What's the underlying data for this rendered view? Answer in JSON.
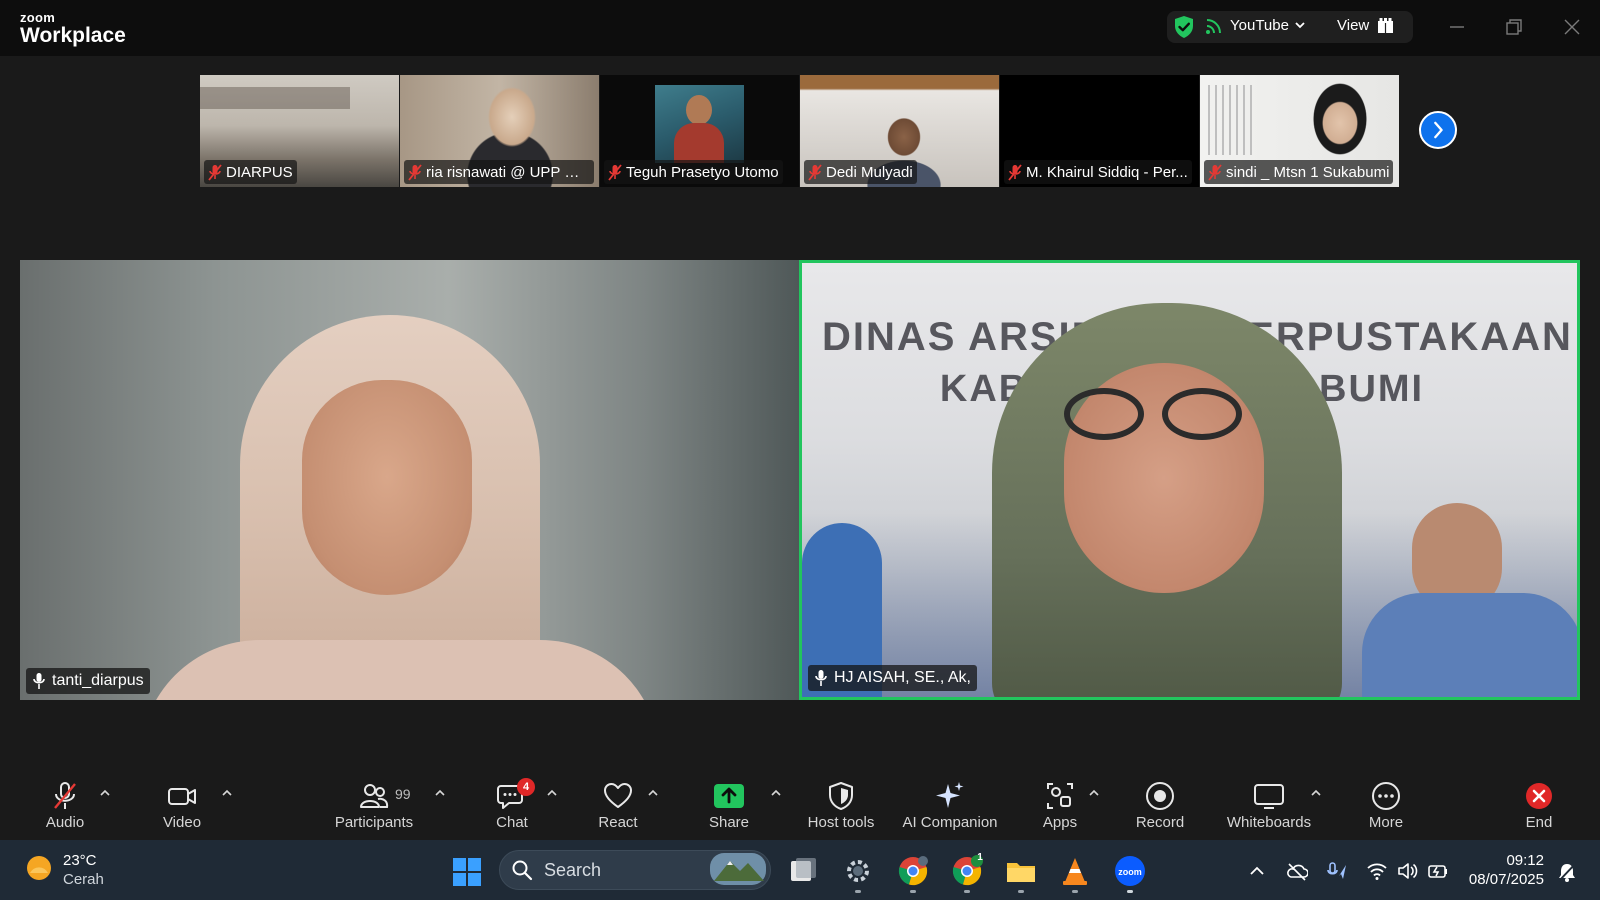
{
  "app": {
    "logo_top": "zoom",
    "logo_bottom": "Workplace"
  },
  "titlebar": {
    "stream_label": "YouTube",
    "view_label": "View"
  },
  "thumbnails": [
    {
      "name": "DIARPUS"
    },
    {
      "name": "ria risnawati @ UPP Cl..."
    },
    {
      "name": "Teguh Prasetyo Utomo"
    },
    {
      "name": "Dedi Mulyadi"
    },
    {
      "name": "M. Khairul Siddiq - Per..."
    },
    {
      "name": "sindi _ Mtsn 1 Sukabumi"
    }
  ],
  "videos": {
    "left": {
      "name": "tanti_diarpus"
    },
    "right": {
      "name": "HJ AISAH, SE., Ak,",
      "backdrop_line1": "DINAS ARSIP DAN PERPUSTAKAAN",
      "backdrop_line2": "KABUPATEN SUKABUMI"
    }
  },
  "toolbar": {
    "audio": "Audio",
    "video": "Video",
    "participants": "Participants",
    "participants_count": "99",
    "chat": "Chat",
    "chat_badge": "4",
    "react": "React",
    "share": "Share",
    "host_tools": "Host tools",
    "ai_companion": "AI Companion",
    "apps": "Apps",
    "record": "Record",
    "whiteboards": "Whiteboards",
    "more": "More",
    "end": "End"
  },
  "taskbar": {
    "temperature": "23°C",
    "condition": "Cerah",
    "search_placeholder": "Search",
    "chrome_badge": "1",
    "time": "09:12",
    "date": "08/07/2025"
  },
  "colors": {
    "active_speaker_border": "#22c55e",
    "accent_blue": "#0e72ed",
    "share_green": "#22c55e",
    "muted_red": "#e02828"
  }
}
